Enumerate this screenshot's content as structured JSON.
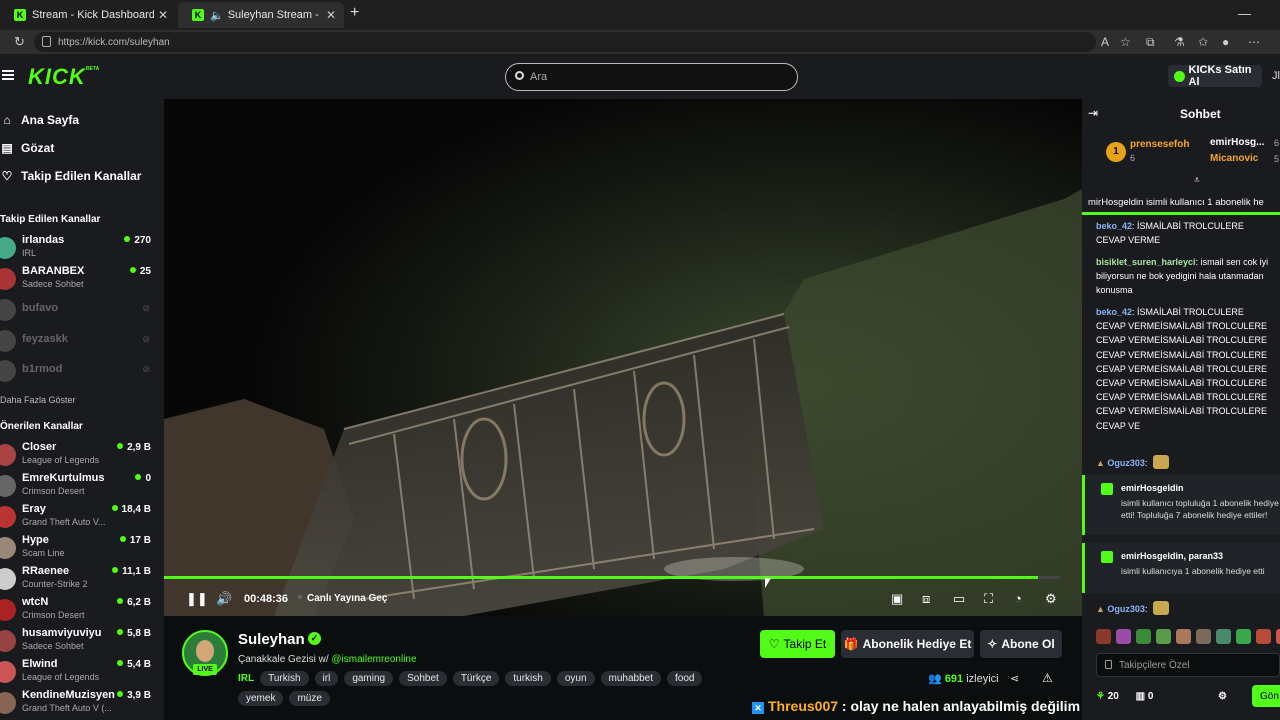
{
  "browser": {
    "tabs": [
      {
        "title": "Stream - Kick Dashboard",
        "active": false
      },
      {
        "title": "Suleyhan Stream - Watch Live",
        "active": true
      }
    ],
    "url": "https://kick.com/suleyhan"
  },
  "header": {
    "logo": "KICK",
    "logo_tag": "BETA",
    "search_placeholder": "Ara",
    "kicks_button": "KICKs Satın Al",
    "user_initials": "Jl"
  },
  "sidebar": {
    "nav": [
      {
        "label": "Ana Sayfa",
        "icon": "home-icon"
      },
      {
        "label": "Gözat",
        "icon": "browse-icon"
      },
      {
        "label": "Takip Edilen Kanallar",
        "icon": "heart-icon"
      }
    ],
    "followed_title": "Takip Edilen Kanallar",
    "followed": [
      {
        "name": "irlandas",
        "category": "IRL",
        "viewers": "270",
        "online": true
      },
      {
        "name": "BARANBEX",
        "category": "Sadece Sohbet",
        "viewers": "25",
        "online": true
      },
      {
        "name": "bufavo",
        "online": false
      },
      {
        "name": "feyzaskk",
        "online": false
      },
      {
        "name": "b1rmod",
        "online": false
      }
    ],
    "show_more": "Daha Fazla Göster",
    "recommended_title": "Önerilen Kanallar",
    "recommended": [
      {
        "name": "Closer",
        "category": "League of Legends",
        "viewers": "2,9 B"
      },
      {
        "name": "EmreKurtulmus",
        "category": "Crimson Desert",
        "viewers": "0"
      },
      {
        "name": "Eray",
        "category": "Grand Theft Auto V...",
        "viewers": "18,4 B"
      },
      {
        "name": "Hype",
        "category": "Scam Line",
        "viewers": "17 B"
      },
      {
        "name": "RRaenee",
        "category": "Counter-Strike 2",
        "viewers": "11,1 B"
      },
      {
        "name": "wtcN",
        "category": "Crimson Desert",
        "viewers": "6,2 B"
      },
      {
        "name": "husamviyuviyu",
        "category": "Sadece Sohbet",
        "viewers": "5,8 B"
      },
      {
        "name": "Elwind",
        "category": "League of Legends",
        "viewers": "5,4 B"
      },
      {
        "name": "KendineMuzisyen",
        "category": "Grand Theft Auto V (...",
        "viewers": "3,9 B"
      }
    ]
  },
  "player": {
    "time": "00:48:36",
    "live_label": "Canlı Yayına Geç",
    "progress_fraction": 0.976
  },
  "stream": {
    "streamer": "Suleyhan",
    "live_badge": "LIVE",
    "title_prefix": "Çanakkale Gezisi w/ ",
    "title_mention": "@ismailemreonline",
    "category": "IRL",
    "tags": [
      "Turkish",
      "irl",
      "gaming",
      "Sohbet",
      "Türkçe",
      "turkish",
      "oyun",
      "muhabbet",
      "food",
      "yemek",
      "müze"
    ],
    "follow_btn": "Takip Et",
    "gift_btn": "Abonelik Hediye Et",
    "subscribe_btn": "Abone Ol",
    "viewers": "691",
    "viewers_label": "izleyici",
    "caption_user": "Threus007",
    "caption_text": " : olay ne halen anlayabilmiş değilim"
  },
  "chat": {
    "title": "Sohbet",
    "top_gifters": [
      {
        "rank": "1",
        "name": "prensesefoh",
        "count": "6"
      },
      {
        "name": "emirHosg...",
        "count": "6"
      },
      {
        "name": "Micanovic",
        "count": "5"
      }
    ],
    "banner": "mirHosgeldin isimli kullanıcı 1 abonelik he",
    "messages": [
      {
        "user": "beko_42",
        "user_color": "#8ab4f8",
        "text": ": İSMAİLABİ TROLCULERE CEVAP VERME"
      },
      {
        "user": "bisiklet_suren_harleyci",
        "user_color": "#a8e6a1",
        "text": ": ismail sen cok iyi biliyorsun ne bok yedigini hala utanmadan konusma"
      },
      {
        "user": "beko_42",
        "user_color": "#8ab4f8",
        "text": ": İSMAİLABİ TROLCULERE CEVAP VERMEİSMAİLABİ TROLCULERE CEVAP VERMEİSMAİLABİ TROLCULERE CEVAP VERMEİSMAİLABİ TROLCULERE CEVAP VERMEİSMAİLABİ TROLCULERE CEVAP VERMEİSMAİLABİ TROLCULERE CEVAP VERMEİSMAİLABİ TROLCULERE CEVAP VERMEİSMAİLABİ TROLCULERE CEVAP VE"
      },
      {
        "user": "Oguz303",
        "user_color": "#8ab4f8",
        "text": ":"
      }
    ],
    "sub_events": [
      {
        "user": "emirHosgeldin",
        "text": "isimli kullanıcı topluluğa 1 abonelik hediye etti! Topluluğa 7 abonelik hediye ettiler!"
      },
      {
        "user": "emirHosgeldin, paran33",
        "text": "isimli kullanıcıya 1 abonelik hediye etti"
      }
    ],
    "last_user": "Oguz303",
    "input_placeholder": "Takipçilere Özel",
    "points": "20",
    "gifts": "0",
    "send_label": "Gön"
  }
}
